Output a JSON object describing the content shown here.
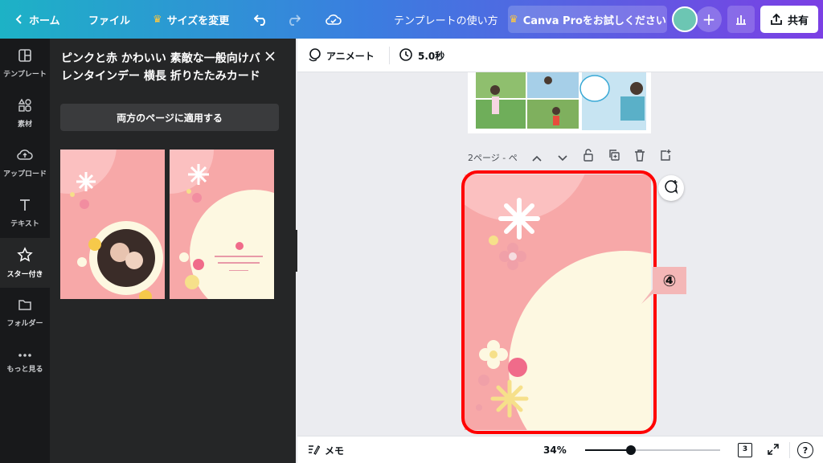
{
  "topbar": {
    "back_label": "ホーム",
    "file_label": "ファイル",
    "resize_label": "サイズを変更",
    "title": "テンプレートの使い方",
    "pro_label": "Canva Proをお試しください",
    "share_label": "共有"
  },
  "rail": {
    "items": [
      {
        "label": "テンプレート",
        "icon": "layout-icon"
      },
      {
        "label": "素材",
        "icon": "shapes-icon"
      },
      {
        "label": "アップロード",
        "icon": "cloud-upload-icon"
      },
      {
        "label": "テキスト",
        "icon": "text-icon"
      },
      {
        "label": "スター付き",
        "icon": "star-icon"
      },
      {
        "label": "フォルダー",
        "icon": "folder-icon"
      },
      {
        "label": "もっと見る",
        "icon": "more-icon"
      }
    ],
    "active_index": 4
  },
  "panel": {
    "title": "ピンクと赤 かわいい 素敵な一般向けバレンタインデー 横長 折りたたみカード",
    "apply_button": "両方のページに適用する"
  },
  "edit_bar": {
    "animate_label": "アニメート",
    "duration_label": "5.0秒"
  },
  "canvas": {
    "page_label": "2ページ - ペ",
    "callout_label": "④"
  },
  "bottom_bar": {
    "notes_label": "メモ",
    "zoom_label": "34%",
    "zoom_fraction": 0.34,
    "page_count": "3",
    "help_label": "?"
  },
  "colors": {
    "accent_red": "#ff0000",
    "card_pink": "#f7a8a8",
    "card_cream": "#fdf8e1"
  }
}
